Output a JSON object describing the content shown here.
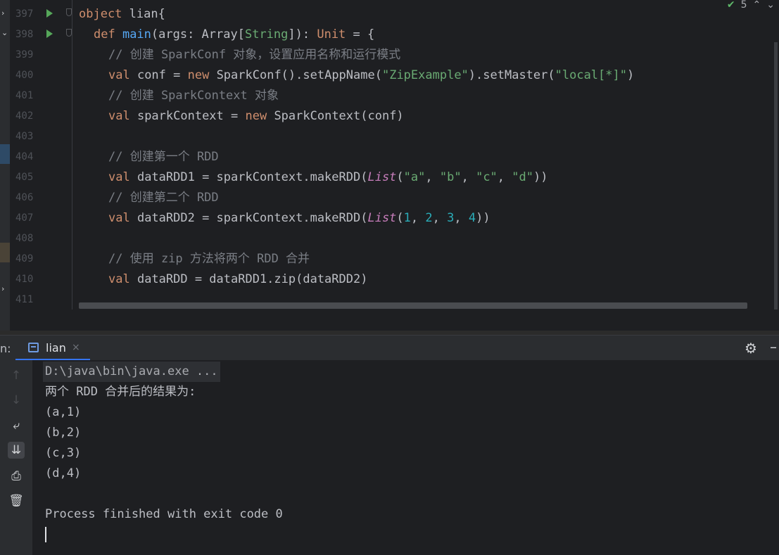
{
  "editor": {
    "lines": [
      {
        "num": "397",
        "run": true,
        "fold": true,
        "indent": 0,
        "tokens": [
          [
            "kw",
            "object"
          ],
          [
            "pl",
            " lian{"
          ]
        ]
      },
      {
        "num": "398",
        "run": true,
        "fold": true,
        "indent": 1,
        "tokens": [
          [
            "kw",
            "def "
          ],
          [
            "fn",
            "main"
          ],
          [
            "pl",
            "(args: Array["
          ],
          [
            "tp",
            "String"
          ],
          [
            "pl",
            "]): "
          ],
          [
            "kw",
            "Unit"
          ],
          [
            "pl",
            " = {"
          ]
        ]
      },
      {
        "num": "399",
        "indent": 2,
        "tokens": [
          [
            "cmt",
            "// 创建 SparkConf 对象，设置应用名称和运行模式"
          ]
        ]
      },
      {
        "num": "400",
        "indent": 2,
        "tokens": [
          [
            "kw",
            "val "
          ],
          [
            "pl",
            "conf = "
          ],
          [
            "kw",
            "new "
          ],
          [
            "pl",
            "SparkConf().setAppName("
          ],
          [
            "str",
            "\"ZipExample\""
          ],
          [
            "pl",
            ").setMaster("
          ],
          [
            "str",
            "\"local[*]\""
          ],
          [
            "pl",
            ")"
          ]
        ]
      },
      {
        "num": "401",
        "indent": 2,
        "tokens": [
          [
            "cmt",
            "// 创建 SparkContext 对象"
          ]
        ]
      },
      {
        "num": "402",
        "indent": 2,
        "tokens": [
          [
            "kw",
            "val "
          ],
          [
            "pl",
            "sparkContext = "
          ],
          [
            "kw",
            "new "
          ],
          [
            "pl",
            "SparkContext(conf)"
          ]
        ]
      },
      {
        "num": "403",
        "indent": 2,
        "tokens": []
      },
      {
        "num": "404",
        "indent": 2,
        "tokens": [
          [
            "cmt",
            "// 创建第一个 RDD"
          ]
        ]
      },
      {
        "num": "405",
        "indent": 2,
        "tokens": [
          [
            "kw",
            "val "
          ],
          [
            "pl",
            "dataRDD1 = sparkContext.makeRDD("
          ],
          [
            "ty",
            "List"
          ],
          [
            "pl",
            "("
          ],
          [
            "str",
            "\"a\""
          ],
          [
            "pl",
            ", "
          ],
          [
            "str",
            "\"b\""
          ],
          [
            "pl",
            ", "
          ],
          [
            "str",
            "\"c\""
          ],
          [
            "pl",
            ", "
          ],
          [
            "str",
            "\"d\""
          ],
          [
            "pl",
            "))"
          ]
        ]
      },
      {
        "num": "406",
        "indent": 2,
        "tokens": [
          [
            "cmt",
            "// 创建第二个 RDD"
          ]
        ]
      },
      {
        "num": "407",
        "indent": 2,
        "tokens": [
          [
            "kw",
            "val "
          ],
          [
            "pl",
            "dataRDD2 = sparkContext.makeRDD("
          ],
          [
            "ty",
            "List"
          ],
          [
            "pl",
            "("
          ],
          [
            "num",
            "1"
          ],
          [
            "pl",
            ", "
          ],
          [
            "num",
            "2"
          ],
          [
            "pl",
            ", "
          ],
          [
            "num",
            "3"
          ],
          [
            "pl",
            ", "
          ],
          [
            "num",
            "4"
          ],
          [
            "pl",
            "))"
          ]
        ]
      },
      {
        "num": "408",
        "indent": 2,
        "tokens": []
      },
      {
        "num": "409",
        "indent": 2,
        "tokens": [
          [
            "cmt",
            "// 使用 zip 方法将两个 RDD 合并"
          ]
        ]
      },
      {
        "num": "410",
        "indent": 2,
        "tokens": [
          [
            "kw",
            "val "
          ],
          [
            "pl",
            "dataRDD = dataRDD1.zip(dataRDD2)"
          ]
        ]
      },
      {
        "num": "411",
        "indent": 2,
        "tokens": []
      }
    ],
    "inspection_count": "5"
  },
  "toolwindow": {
    "run_label": "n:",
    "tab_label": "lian",
    "tab_close": "×"
  },
  "console": {
    "command": "D:\\java\\bin\\java.exe ...",
    "output": [
      "两个 RDD 合并后的结果为:",
      "(a,1)",
      "(b,2)",
      "(c,3)",
      "(d,4)",
      "",
      "Process finished with exit code 0"
    ]
  },
  "colors": {
    "keyword": "#cf8e6d",
    "string": "#6aab73",
    "number": "#2aacb8",
    "comment": "#7a7e85",
    "function": "#56a8f5",
    "accent": "#3574f0"
  }
}
